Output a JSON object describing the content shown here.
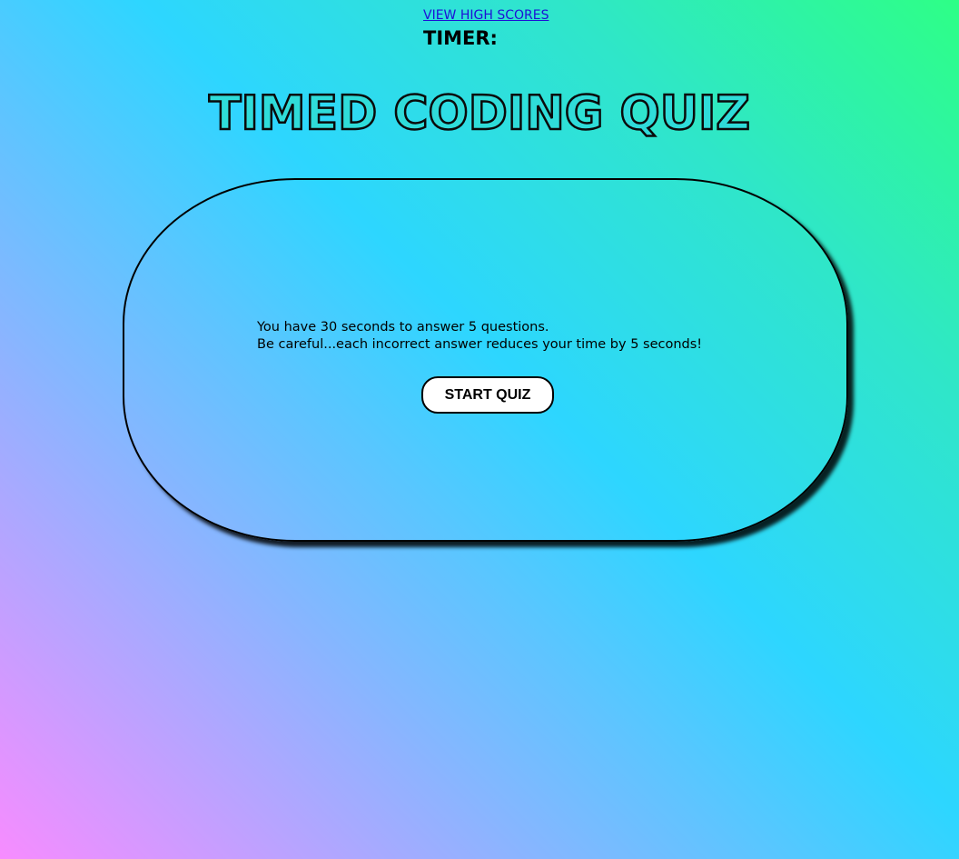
{
  "nav": {
    "high_scores_label": "VIEW HIGH SCORES",
    "timer_label": "TIMER:"
  },
  "header": {
    "title": "TIMED CODING QUIZ"
  },
  "quiz": {
    "instruction_line1": "You have 30 seconds to answer 5 questions.",
    "instruction_line2": "Be careful...each incorrect answer reduces your time by 5 seconds!",
    "start_label": "START QUIZ"
  },
  "colors": {
    "gradient_pink": "#f78cff",
    "gradient_cyan": "#2dd6ff",
    "gradient_green": "#2eff86",
    "link_blue": "#1e10d6"
  }
}
